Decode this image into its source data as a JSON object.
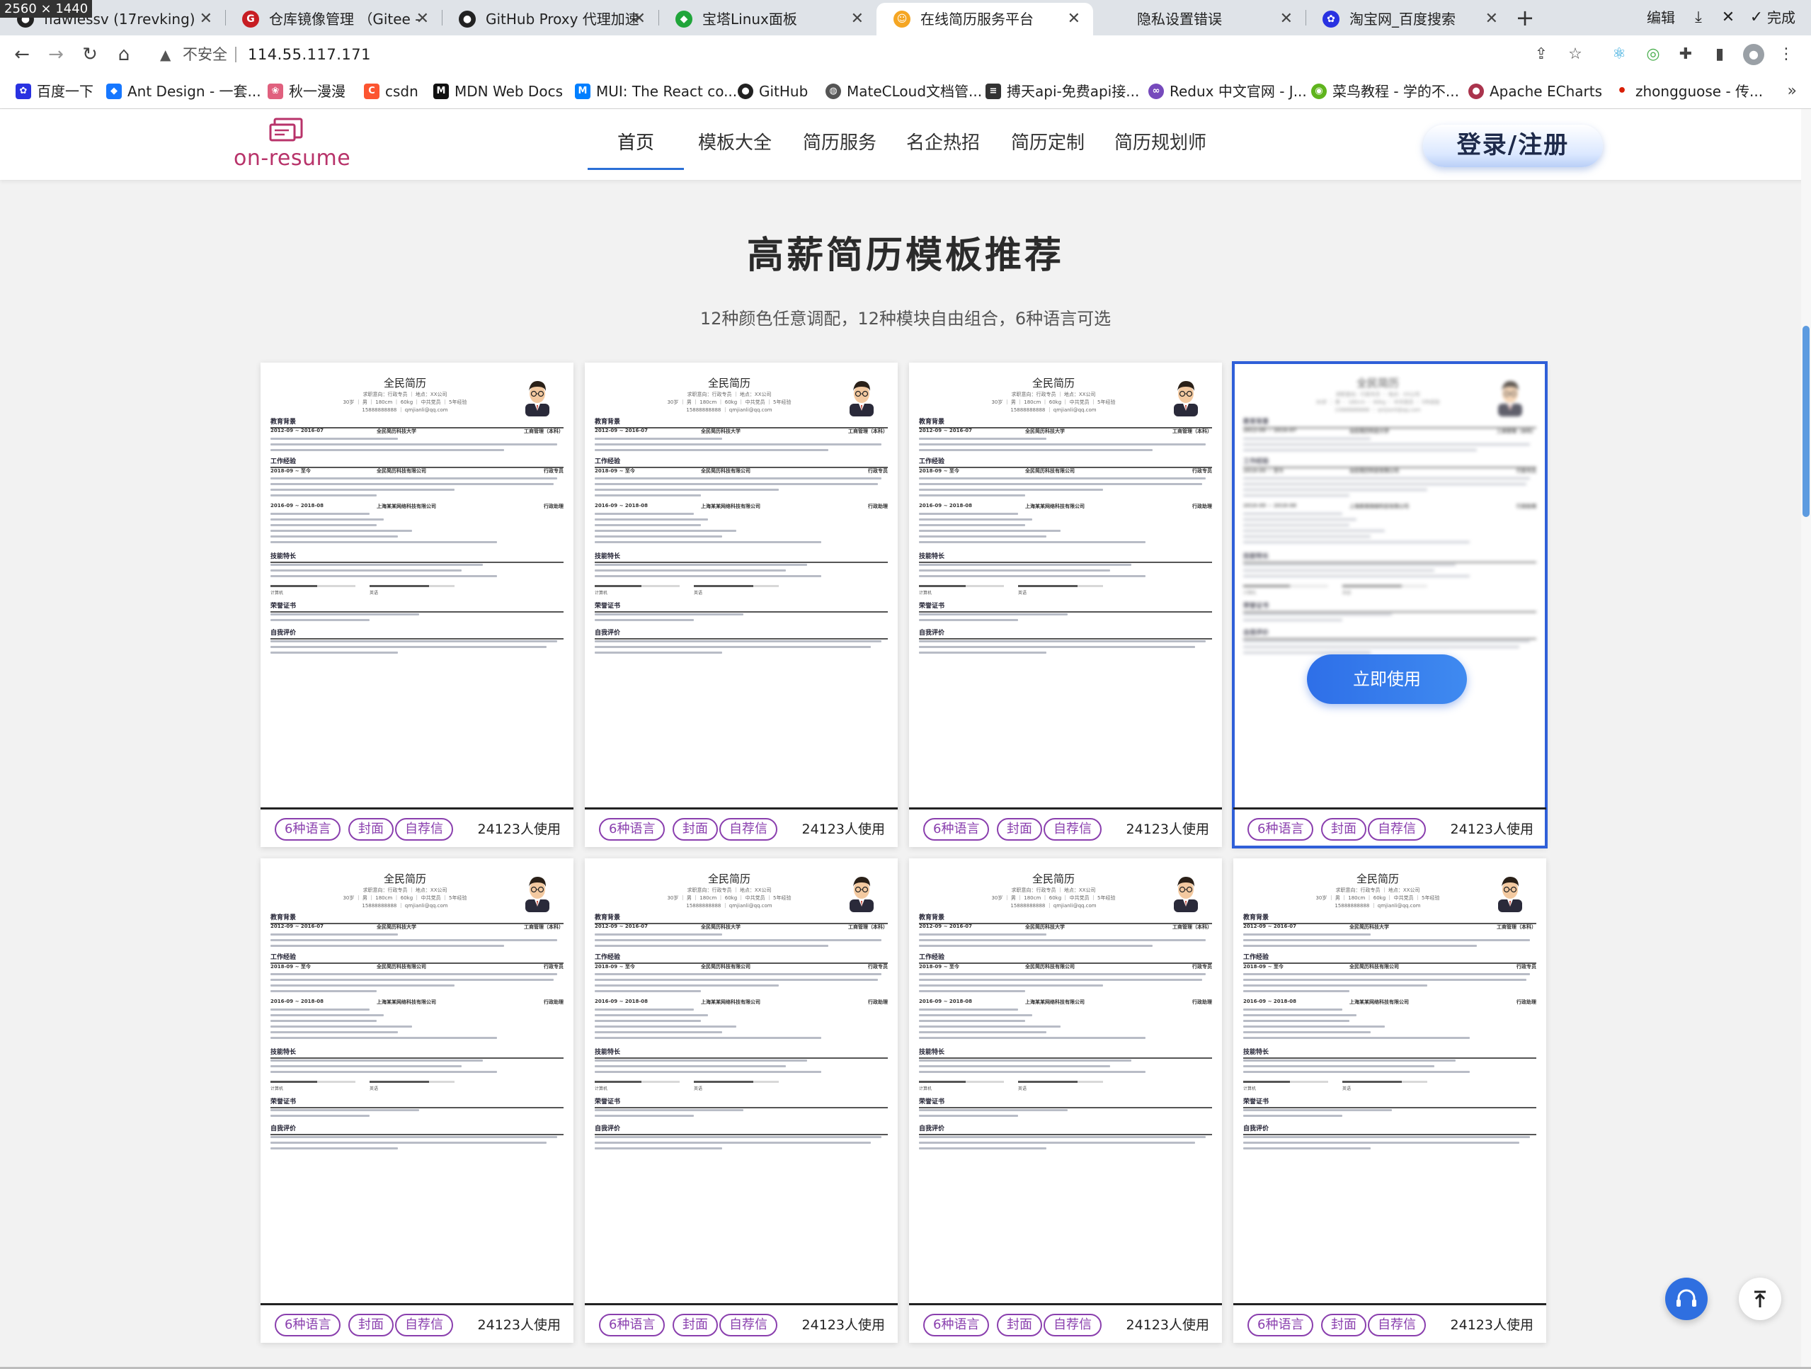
{
  "screen_badge": "2560 × 1440",
  "browser": {
    "tabs": [
      {
        "title": "flawlessv (17revking)",
        "icon": "github-icon",
        "color": "#222222"
      },
      {
        "title": "仓库镜像管理 （Gitee -",
        "icon": "gitee-icon",
        "color": "#c71d23"
      },
      {
        "title": "GitHub Proxy 代理加速",
        "icon": "github-icon",
        "color": "#222222"
      },
      {
        "title": "宝塔Linux面板",
        "icon": "shield-icon",
        "color": "#20a53a"
      },
      {
        "title": "在线简历服务平台",
        "icon": "smile-icon",
        "color": "#f5a623",
        "active": true
      },
      {
        "title": "隐私设置错误",
        "icon": "warning-icon",
        "color": "#d93025"
      },
      {
        "title": "淘宝网_百度搜索",
        "icon": "baidu-paw-icon",
        "color": "#2932e1"
      }
    ],
    "new_tab_label": "+",
    "edit_label": "编辑",
    "done_label": "完成",
    "url_security": "不安全",
    "url": "114.55.117.171",
    "bookmarks": [
      {
        "label": "百度一下",
        "icon": "baidu-paw-icon",
        "color": "#2932e1"
      },
      {
        "label": "Ant Design - 一套...",
        "icon": "ant-design-icon",
        "color": "#1677ff"
      },
      {
        "label": "秋一漫漫",
        "icon": "flower-icon",
        "color": "#e0607e"
      },
      {
        "label": "csdn",
        "icon": "csdn-icon",
        "color": "#fc5531"
      },
      {
        "label": "MDN Web Docs",
        "icon": "mdn-icon",
        "color": "#111111"
      },
      {
        "label": "MUI: The React co...",
        "icon": "mui-icon",
        "color": "#007fff"
      },
      {
        "label": "GitHub",
        "icon": "github-icon",
        "color": "#222222"
      },
      {
        "label": "MateCLoud文档管...",
        "icon": "globe-icon",
        "color": "#555555"
      },
      {
        "label": "搏天api-免费api接...",
        "icon": "api-icon",
        "color": "#333333"
      },
      {
        "label": "Redux 中文官网 - J...",
        "icon": "redux-icon",
        "color": "#764abc"
      },
      {
        "label": "菜鸟教程 - 学的不...",
        "icon": "runoob-icon",
        "color": "#5fb41d"
      },
      {
        "label": "Apache ECharts",
        "icon": "echarts-icon",
        "color": "#aa344d"
      },
      {
        "label": "zhongguose - 传...",
        "icon": "dot-icon",
        "color": "#d81e06"
      }
    ]
  },
  "site": {
    "logo_text": "on-resume",
    "brand_color": "#b8336a",
    "nav": [
      {
        "label": "首页",
        "active": true
      },
      {
        "label": "模板大全"
      },
      {
        "label": "简历服务"
      },
      {
        "label": "名企热招"
      },
      {
        "label": "简历定制"
      },
      {
        "label": "简历规划师"
      }
    ],
    "login_label": "登录/注册"
  },
  "main": {
    "heading": "高薪简历模板推荐",
    "subheading": "12种颜色任意调配，12种模块自由组合，6种语言可选",
    "hover_button_label": "立即使用",
    "hovered_card_index": 3,
    "resume_preview": {
      "title": "全民简历",
      "meta_line1": "求职意向：行政专员 ｜ 地点：XX公司",
      "meta_line2": "30岁 ｜ 男 ｜ 180cm ｜ 60kg ｜ 中共党员 ｜ 5年经验",
      "meta_line3": "15888888888 ｜ qmjianli@qq.com",
      "section_education": "教育背景",
      "edu_date": "2012-09 ~ 2016-07",
      "edu_school": "全民简历科技大学",
      "edu_major": "工商管理（本科）",
      "section_work": "工作经验",
      "work1_date": "2018-09 ~ 至今",
      "work1_company": "全民简历科技有限公司",
      "work1_role": "行政专员",
      "work2_date": "2016-09 ~ 2018-08",
      "work2_company": "上海某某网络科技有限公司",
      "work2_role": "行政助理",
      "section_skills": "技能特长",
      "skill1": "计算机",
      "skill2": "英语",
      "section_certs": "荣誉证书",
      "section_self": "自我评价"
    },
    "cards": [
      {
        "tags": [
          "6种语言",
          "封面",
          "自荐信"
        ],
        "usage": "24123人使用"
      },
      {
        "tags": [
          "6种语言",
          "封面",
          "自荐信"
        ],
        "usage": "24123人使用"
      },
      {
        "tags": [
          "6种语言",
          "封面",
          "自荐信"
        ],
        "usage": "24123人使用"
      },
      {
        "tags": [
          "6种语言",
          "封面",
          "自荐信"
        ],
        "usage": "24123人使用"
      },
      {
        "tags": [
          "6种语言",
          "封面",
          "自荐信"
        ],
        "usage": "24123人使用"
      },
      {
        "tags": [
          "6种语言",
          "封面",
          "自荐信"
        ],
        "usage": "24123人使用"
      },
      {
        "tags": [
          "6种语言",
          "封面",
          "自荐信"
        ],
        "usage": "24123人使用"
      },
      {
        "tags": [
          "6种语言",
          "封面",
          "自荐信"
        ],
        "usage": "24123人使用"
      }
    ],
    "skill_levels": [
      0.55,
      0.7
    ]
  },
  "colors": {
    "accent": "#2f5fd8",
    "tag": "#8a3fae",
    "nav_underline": "#2b6fd6"
  }
}
